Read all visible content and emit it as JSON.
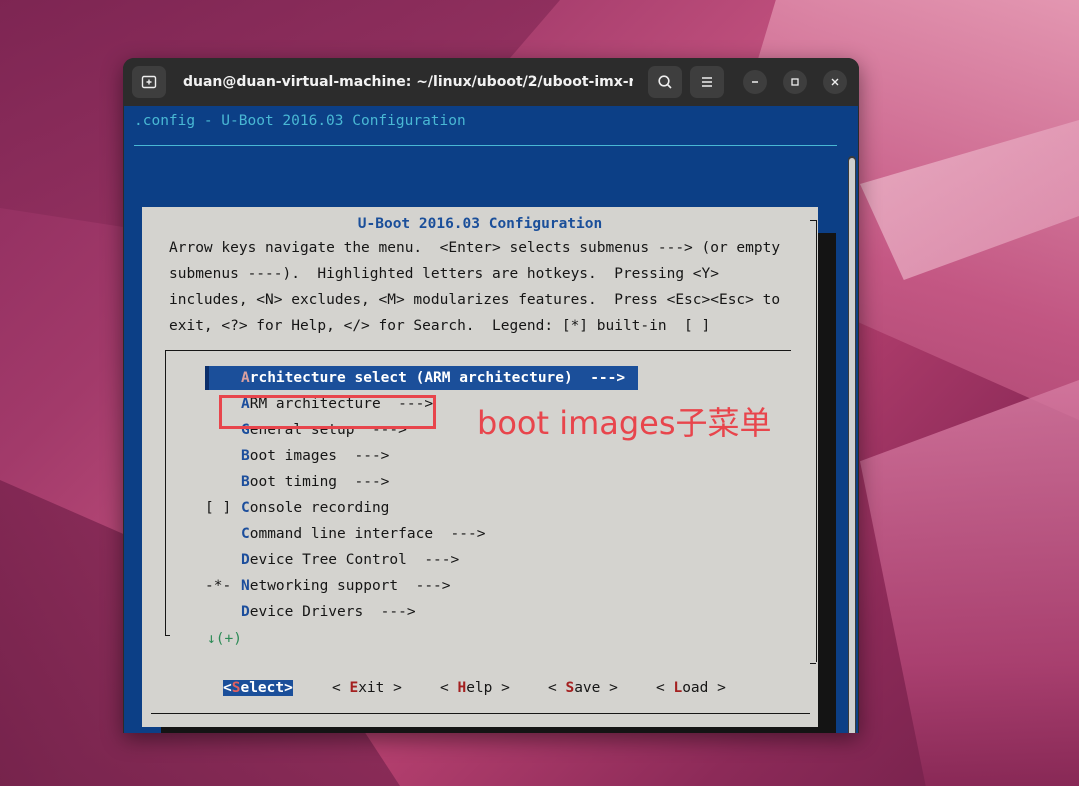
{
  "window": {
    "title": "duan@duan-virtual-machine: ~/linux/uboot/2/uboot-imx-rel..."
  },
  "terminal": {
    "top_line": ".config - U-Boot 2016.03 Configuration",
    "dialog_title": "U-Boot 2016.03 Configuration",
    "help_lines": [
      "Arrow keys navigate the menu.  <Enter> selects submenus ---> (or empty",
      "submenus ----).  Highlighted letters are hotkeys.  Pressing <Y>",
      "includes, <N> excludes, <M> modularizes features.  Press <Esc><Esc> to",
      "exit, <?> for Help, </> for Search.  Legend: [*] built-in  [ ]"
    ],
    "menu_items": [
      {
        "prefix": "",
        "hotkey": "A",
        "rest": "rchitecture select (ARM architecture)  --->",
        "selected": true
      },
      {
        "prefix": "",
        "hotkey": "A",
        "rest": "RM architecture  --->"
      },
      {
        "prefix": "",
        "hotkey": "G",
        "rest": "eneral setup  --->"
      },
      {
        "prefix": "",
        "hotkey": "B",
        "rest": "oot images  --->"
      },
      {
        "prefix": "",
        "hotkey": "B",
        "rest": "oot timing  --->"
      },
      {
        "prefix": "[ ]",
        "hotkey": "C",
        "rest": "onsole recording"
      },
      {
        "prefix": "",
        "hotkey": "C",
        "rest": "ommand line interface  --->"
      },
      {
        "prefix": "",
        "hotkey": "D",
        "rest": "evice Tree Control  --->"
      },
      {
        "prefix": "-*-",
        "hotkey": "N",
        "rest": "etworking support  --->"
      },
      {
        "prefix": "",
        "hotkey": "D",
        "rest": "evice Drivers  --->"
      }
    ],
    "more_indicator": "↓(+)",
    "buttons": [
      {
        "open": "<",
        "hotkey": "S",
        "rest": "elect",
        "close": ">",
        "active": true
      },
      {
        "open": "< ",
        "hotkey": "E",
        "rest": "xit",
        "close": " >"
      },
      {
        "open": "< ",
        "hotkey": "H",
        "rest": "elp",
        "close": " >"
      },
      {
        "open": "< ",
        "hotkey": "S",
        "rest": "ave",
        "close": " >"
      },
      {
        "open": "< ",
        "hotkey": "L",
        "rest": "oad",
        "close": " >"
      }
    ]
  },
  "annotation": {
    "text": "boot images子菜单",
    "color": "#e8454c"
  },
  "colors": {
    "terminal_bg": "#0c3f86",
    "dialog_bg": "#d4d3cf",
    "highlight": "#1b4f9a",
    "cyan_text": "#49b8d4"
  }
}
